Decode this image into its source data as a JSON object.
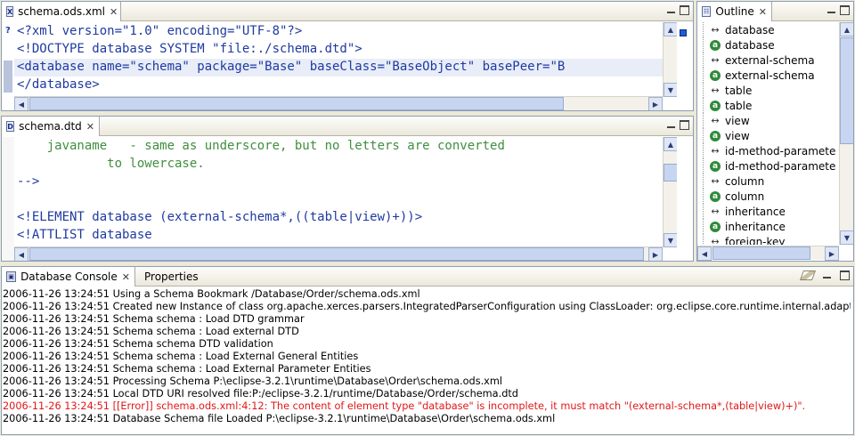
{
  "editor_xml": {
    "tab_label": "schema.ods.xml",
    "tab_icon": "X",
    "close": "✕",
    "lines": [
      "<?xml version=\"1.0\" encoding=\"UTF-8\"?>",
      "<!DOCTYPE database SYSTEM \"file:./schema.dtd\">",
      "<database name=\"schema\" package=\"Base\" baseClass=\"BaseObject\" basePeer=\"B",
      "</database>"
    ],
    "gutter_marker": "?"
  },
  "editor_dtd": {
    "tab_label": "schema.dtd",
    "tab_icon": "D",
    "close": "✕",
    "lines": [
      "    javaname   - same as underscore, but no letters are converted",
      "            to lowercase.",
      "-->",
      "",
      "<!ELEMENT database (external-schema*,((table|view)+))>",
      "<!ATTLIST database"
    ]
  },
  "outline": {
    "tab_label": "Outline",
    "close": "✕",
    "items": [
      {
        "kind": "element",
        "label": "database"
      },
      {
        "kind": "attribute",
        "label": "database"
      },
      {
        "kind": "element",
        "label": "external-schema"
      },
      {
        "kind": "attribute",
        "label": "external-schema"
      },
      {
        "kind": "element",
        "label": "table"
      },
      {
        "kind": "attribute",
        "label": "table"
      },
      {
        "kind": "element",
        "label": "view"
      },
      {
        "kind": "attribute",
        "label": "view"
      },
      {
        "kind": "element",
        "label": "id-method-paramete"
      },
      {
        "kind": "attribute",
        "label": "id-method-paramete"
      },
      {
        "kind": "element",
        "label": "column"
      },
      {
        "kind": "attribute",
        "label": "column"
      },
      {
        "kind": "element",
        "label": "inheritance"
      },
      {
        "kind": "attribute",
        "label": "inheritance"
      },
      {
        "kind": "element",
        "label": "foreign-key"
      }
    ],
    "element_glyph": "↔",
    "attribute_glyph": "a"
  },
  "console": {
    "tab_label": "Database Console",
    "close": "✕",
    "other_tab_label": "Properties",
    "lines": [
      {
        "text": "2006-11-26 13:24:51 Using a Schema Bookmark /Database/Order/schema.ods.xml",
        "error": false
      },
      {
        "text": "2006-11-26 13:24:51 Created new Instance of class org.apache.xerces.parsers.IntegratedParserConfiguration using ClassLoader: org.eclipse.core.runtime.internal.adaptor.",
        "error": false
      },
      {
        "text": "2006-11-26 13:24:51 Schema schema : Load DTD grammar",
        "error": false
      },
      {
        "text": "2006-11-26 13:24:51 Schema schema : Load external DTD",
        "error": false
      },
      {
        "text": "2006-11-26 13:24:51 Schema schema DTD validation",
        "error": false
      },
      {
        "text": "2006-11-26 13:24:51 Schema schema : Load External General Entities",
        "error": false
      },
      {
        "text": "2006-11-26 13:24:51 Schema schema : Load External Parameter Entities",
        "error": false
      },
      {
        "text": "2006-11-26 13:24:51 Processing Schema P:\\eclipse-3.2.1\\runtime\\Database\\Order\\schema.ods.xml",
        "error": false
      },
      {
        "text": "2006-11-26 13:24:51 Local DTD URI resolved file:P:/eclipse-3.2.1/runtime/Database/Order/schema.dtd",
        "error": false
      },
      {
        "text": "2006-11-26 13:24:51 [[Error]] schema.ods.xml:4:12: The content of element type \"database\" is incomplete, it must match \"(external-schema*,(table|view)+)\".",
        "error": true
      },
      {
        "text": "2006-11-26 13:24:51 Database Schema file Loaded P:\\eclipse-3.2.1\\runtime\\Database\\Order\\schema.ods.xml",
        "error": false
      }
    ]
  },
  "colors": {
    "error": "#e01818",
    "xml_tag": "#1f3aa0",
    "comment": "#3f8f3f",
    "selection": "#e8edf8"
  }
}
